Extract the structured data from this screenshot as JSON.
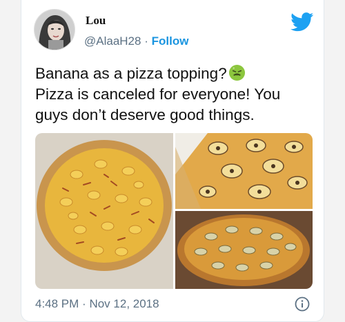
{
  "author": {
    "name": "Lou",
    "handle": "@AlaaH28",
    "separator": "·",
    "follow_label": "Follow"
  },
  "tweet": {
    "line1": "Banana as a pizza topping?",
    "line2": "Pizza is canceled for everyone! You",
    "line3": "guys don’t deserve good things.",
    "emoji": "nauseated-face-icon"
  },
  "footer": {
    "time": "4:48 PM",
    "separator": "·",
    "date": "Nov 12, 2018"
  },
  "colors": {
    "twitter_blue": "#1da1f2",
    "follow_blue": "#1b95e0",
    "muted": "#5b7083"
  }
}
